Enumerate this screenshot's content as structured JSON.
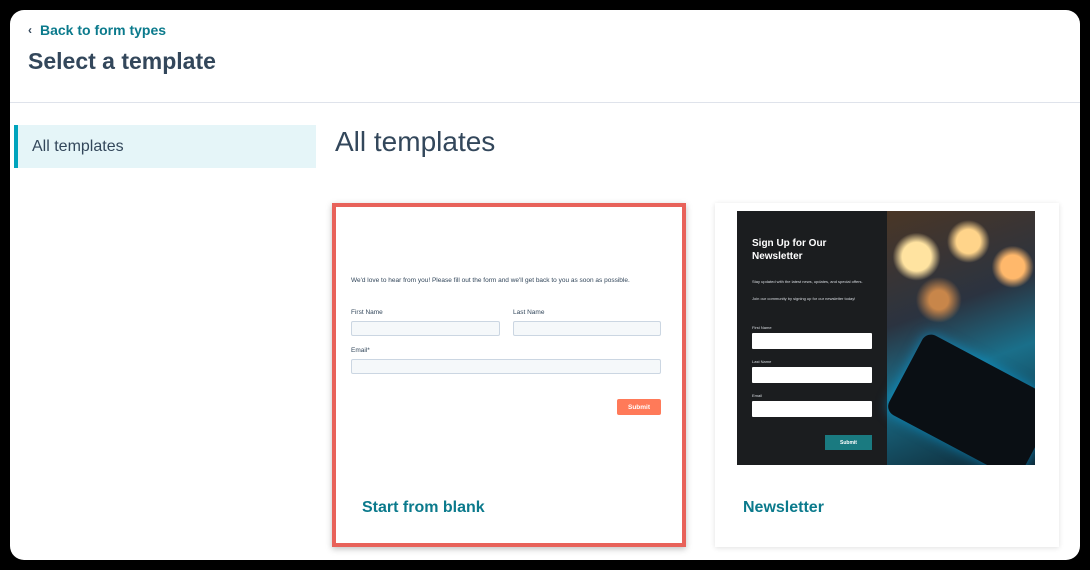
{
  "header": {
    "back_label": "Back to form types",
    "title": "Select a template"
  },
  "sidebar": {
    "items": [
      {
        "label": "All templates",
        "selected": true
      }
    ]
  },
  "main": {
    "section_title": "All templates",
    "templates": [
      {
        "label": "Start from blank",
        "selected": true,
        "preview": {
          "intro": "We'd love to hear from you! Please fill out the form and we'll get back to you as soon as possible.",
          "fields": [
            "First Name",
            "Last Name",
            "Email*"
          ],
          "submit": "Submit"
        }
      },
      {
        "label": "Newsletter",
        "selected": false,
        "preview": {
          "heading": "Sign Up for Our Newsletter",
          "line1": "Stay updated with the latest news, updates, and special offers.",
          "line2": "Join our community by signing up for our newsletter today!",
          "fields": [
            "First Name",
            "Last Name",
            "Email"
          ],
          "submit": "Submit"
        }
      }
    ]
  },
  "colors": {
    "accent": "#0b7a8c",
    "selection_border": "#e8625a",
    "submit_orange": "#ff7a59",
    "sidebar_selected_bg": "#e5f5f8"
  }
}
